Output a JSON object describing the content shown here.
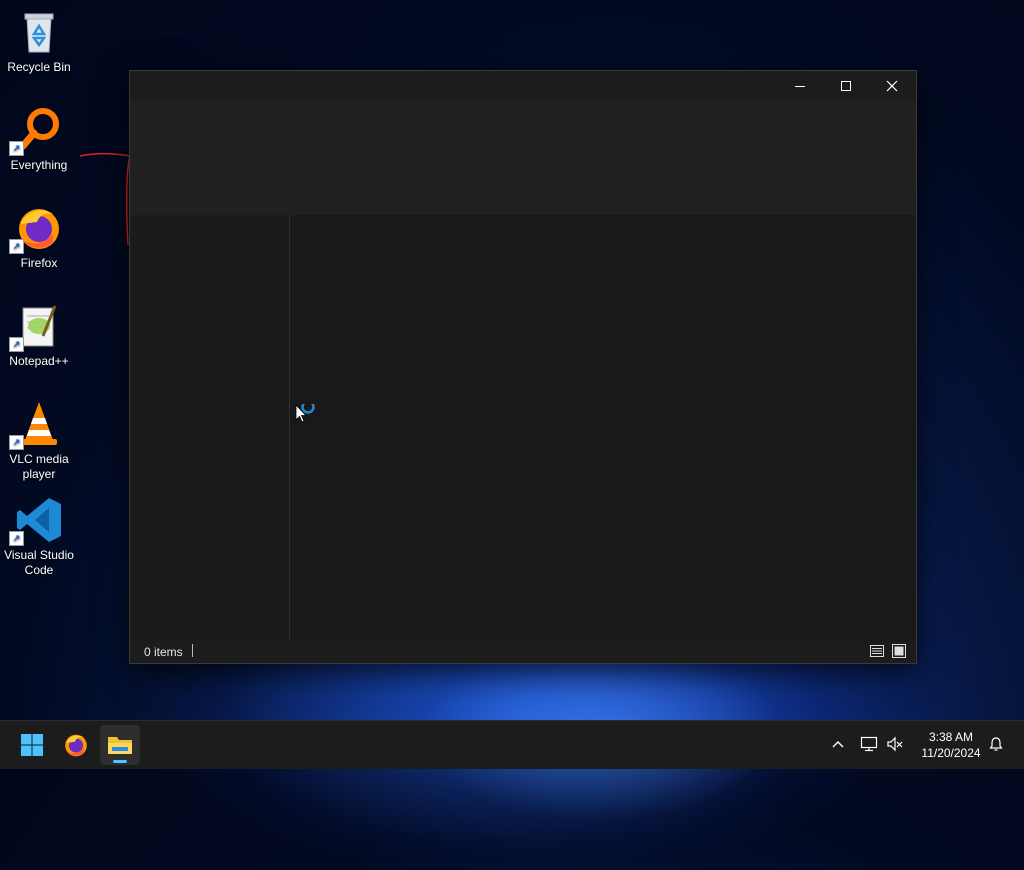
{
  "desktop": {
    "icons": [
      {
        "label": "Recycle Bin",
        "icon": "recycle-bin-icon"
      },
      {
        "label": "Everything",
        "icon": "everything-search-icon"
      },
      {
        "label": "Firefox",
        "icon": "firefox-icon"
      },
      {
        "label": "Notepad++",
        "icon": "notepad-plus-plus-icon"
      },
      {
        "label": "VLC media player",
        "icon": "vlc-icon"
      },
      {
        "label": "Visual Studio Code",
        "icon": "vscode-icon"
      }
    ]
  },
  "window": {
    "title": "",
    "controls": {
      "minimize": "minimize",
      "maximize": "maximize",
      "close": "close"
    },
    "status": {
      "items_label": "0 items"
    },
    "views": [
      "details-view-icon",
      "large-icons-view-icon"
    ]
  },
  "taskbar": {
    "apps": [
      {
        "name": "Start",
        "icon": "windows-start-icon"
      },
      {
        "name": "Firefox",
        "icon": "firefox-icon"
      },
      {
        "name": "File Explorer",
        "icon": "file-explorer-icon",
        "active": true
      }
    ],
    "tray": {
      "icons": [
        "chevron-up-icon",
        "network-icon",
        "volume-muted-icon",
        "notification-bell-icon"
      ]
    },
    "clock": {
      "time": "3:38 AM",
      "date": "11/20/2024"
    }
  },
  "colors": {
    "accent": "#4cc2ff",
    "window_bg": "#1c1c1c",
    "taskbar_bg": "#1c1c1c"
  }
}
